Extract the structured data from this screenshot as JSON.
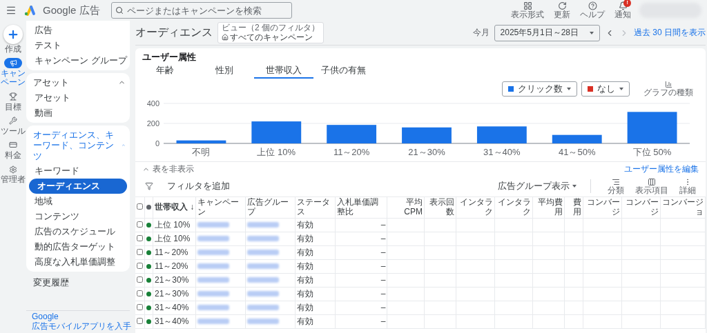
{
  "topbar": {
    "product": "Google 広告",
    "search": {
      "placeholder": "ページまたはキャンペーンを検索"
    },
    "actions": [
      {
        "kind": "view",
        "label": "表示形式"
      },
      {
        "kind": "refresh",
        "label": "更新"
      },
      {
        "kind": "help",
        "label": "ヘルプ"
      },
      {
        "kind": "notify",
        "label": "通知",
        "badge": "!"
      }
    ]
  },
  "rail": [
    {
      "kind": "create",
      "label": "作成",
      "selected": false
    },
    {
      "kind": "campaign",
      "label": "キャンペーン",
      "selected": true
    },
    {
      "kind": "goal",
      "label": "目標",
      "selected": false
    },
    {
      "kind": "tools",
      "label": "ツール",
      "selected": false
    },
    {
      "kind": "billing",
      "label": "料金",
      "selected": false
    },
    {
      "kind": "admin",
      "label": "管理者",
      "selected": false
    }
  ],
  "nav": {
    "groups": [
      {
        "items": [
          {
            "label": "広告",
            "selected": false
          },
          {
            "label": "テスト",
            "selected": false
          },
          {
            "label": "キャンペーン グループ",
            "selected": false
          }
        ]
      },
      {
        "title": "アセット",
        "expanded": true,
        "active": false,
        "items": [
          {
            "label": "アセット",
            "selected": false
          },
          {
            "label": "動画",
            "selected": false
          }
        ]
      },
      {
        "title": "オーディエンス、キーワード、コンテンツ",
        "expanded": true,
        "active": true,
        "items": [
          {
            "label": "キーワード",
            "selected": false
          },
          {
            "label": "オーディエンス",
            "selected": true
          },
          {
            "label": "地域",
            "selected": false
          },
          {
            "label": "コンテンツ",
            "selected": false
          },
          {
            "label": "広告のスケジュール",
            "selected": false
          },
          {
            "label": "動的広告ターゲット",
            "selected": false
          },
          {
            "label": "高度な入札単価調整",
            "selected": false
          }
        ]
      }
    ],
    "history": "変更履歴",
    "promo": {
      "line_1": "Google",
      "line_2": "広告モバイルアプリを入手"
    }
  },
  "page": {
    "title": "オーディエンス",
    "view": {
      "caption": "ビュー（2 個のフィルタ）",
      "value": "すべてのキャンペーン"
    },
    "period_label": "今月",
    "date_range": "2025年5月1日～28日",
    "show_last": "過去 30 日間を表示"
  },
  "card": {
    "title": "ユーザー属性",
    "tabs": [
      {
        "label": "年齢",
        "selected": false
      },
      {
        "label": "性別",
        "selected": false
      },
      {
        "label": "世帯収入",
        "selected": true
      },
      {
        "label": "子供の有無",
        "selected": false
      }
    ],
    "header_checked": false,
    "metric_2": {
      "label": "なし",
      "color": "#d93025"
    },
    "chart_type": "グラフの種類",
    "chart_data": {
      "type": "bar",
      "categories": [
        "不明",
        "上位 10%",
        "11～20%",
        "21～30%",
        "31～40%",
        "41～50%",
        "下位 50%"
      ],
      "series": [
        {
          "name": "クリック数",
          "color": "#1a73e8",
          "values": [
            30,
            220,
            185,
            160,
            170,
            85,
            315
          ]
        }
      ],
      "ylim": [
        0,
        400
      ],
      "yticks": [
        0,
        200,
        400
      ]
    },
    "hide_table": "表を非表示",
    "edit": "ユーザー属性を編集",
    "add_filter": "フィルタを追加",
    "view_mode": "広告グループ表示",
    "tools": [
      {
        "kind": "segment",
        "label": "分類"
      },
      {
        "kind": "columns",
        "label": "表示項目"
      },
      {
        "kind": "more",
        "label": "詳細"
      }
    ],
    "columns": [
      "世帯収入 ↓",
      "キャンペーン",
      "広告グループ",
      "ステータス",
      "入札単価調整比",
      "平均 CPM",
      "表示回数",
      "インタラク",
      "インタラク",
      "平均費用",
      "費用",
      "コンバージ",
      "コンバージ",
      "コンバージョ"
    ],
    "rows": [
      {
        "checked": false,
        "income": "上位 10%",
        "status": "有効",
        "bid": "–"
      },
      {
        "checked": false,
        "income": "上位 10%",
        "status": "有効",
        "bid": "–"
      },
      {
        "checked": false,
        "income": "11～20%",
        "status": "有効",
        "bid": "–"
      },
      {
        "checked": false,
        "income": "11～20%",
        "status": "有効",
        "bid": "–"
      },
      {
        "checked": false,
        "income": "21～30%",
        "status": "有効",
        "bid": "–"
      },
      {
        "checked": false,
        "income": "21～30%",
        "status": "有効",
        "bid": "–"
      },
      {
        "checked": false,
        "income": "31～40%",
        "status": "有効",
        "bid": "–"
      },
      {
        "checked": false,
        "income": "31～40%",
        "status": "有効",
        "bid": "–"
      }
    ]
  }
}
